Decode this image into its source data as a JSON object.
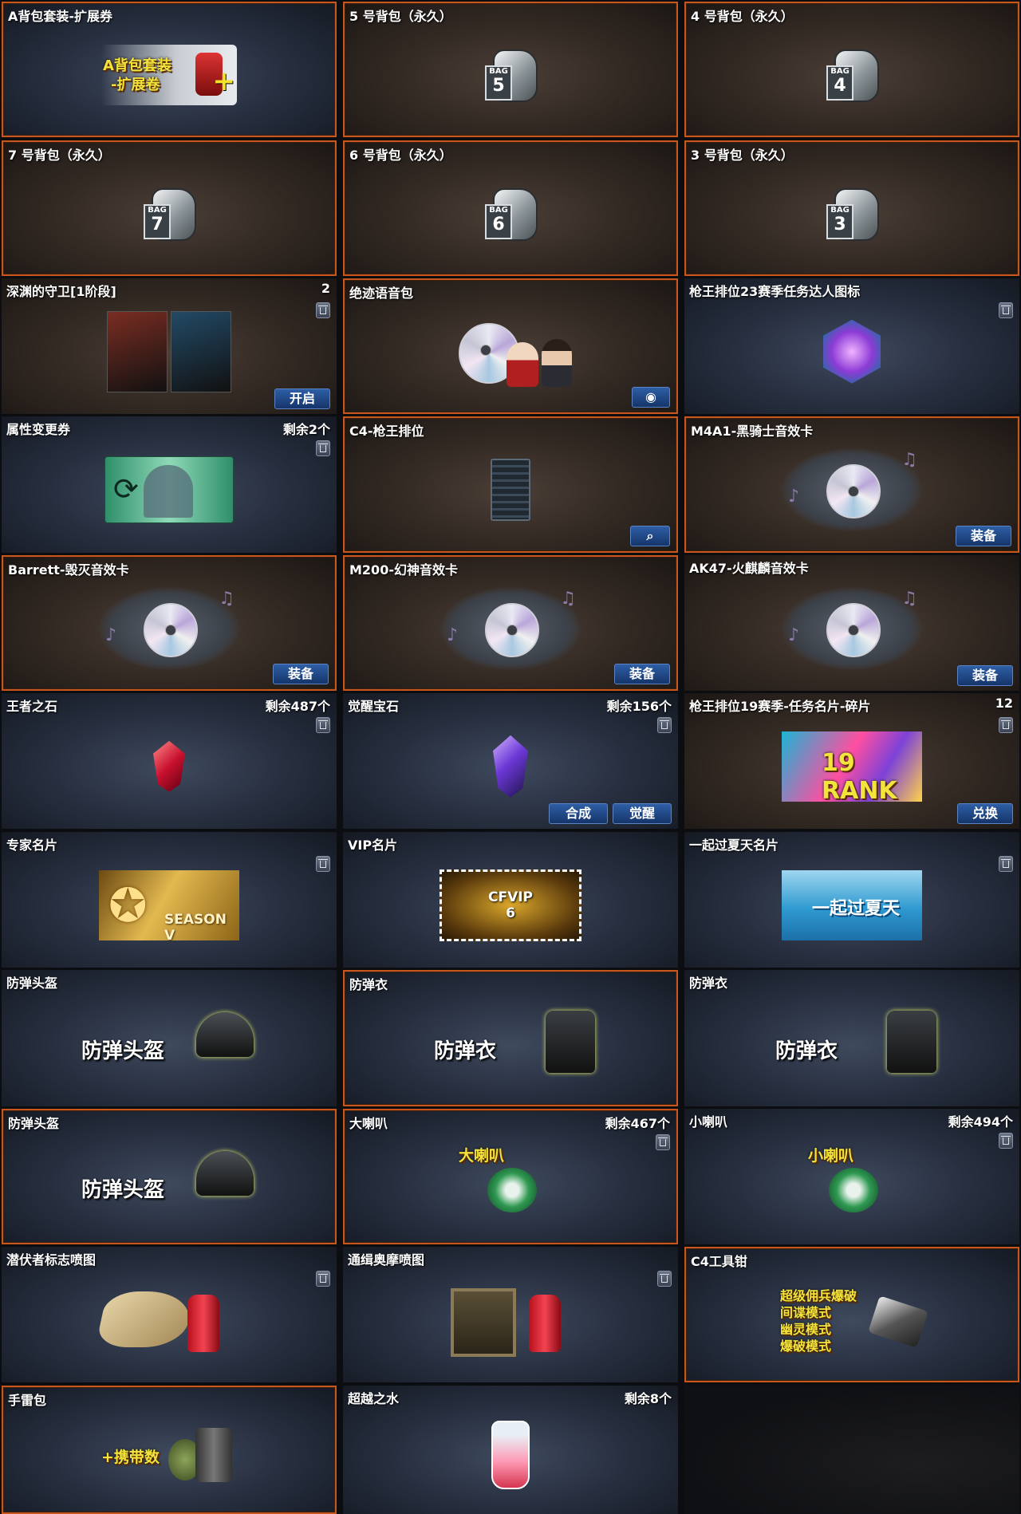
{
  "colors": {
    "orange_border": "#c7571d",
    "button_blue": "#2e5ea5",
    "panel_blue": "#293142",
    "panel_brown": "#352b25"
  },
  "items": [
    {
      "name": "A背包套装-扩展券",
      "art_text": [
        "A背包套装",
        "-扩展卷"
      ],
      "icon": "backpack-expansion-icon"
    },
    {
      "name": "5 号背包（永久）",
      "bag_number": "5",
      "bag_label": "BAG",
      "icon": "bag-icon"
    },
    {
      "name": "4 号背包（永久）",
      "bag_number": "4",
      "bag_label": "BAG",
      "icon": "bag-icon"
    },
    {
      "name": "7 号背包（永久）",
      "bag_number": "7",
      "bag_label": "BAG",
      "icon": "bag-icon"
    },
    {
      "name": "6 号背包（永久）",
      "bag_number": "6",
      "bag_label": "BAG",
      "icon": "bag-icon"
    },
    {
      "name": "3 号背包（永久）",
      "bag_number": "3",
      "bag_label": "BAG",
      "icon": "bag-icon"
    },
    {
      "name": "深渊的守卫[1阶段]",
      "count": "2",
      "button": "开启",
      "icon": "character-cards-icon"
    },
    {
      "name": "绝迹语音包",
      "icon": "voice-pack-icon"
    },
    {
      "name": "枪王排位23赛季任务达人图标",
      "icon": "trophy-badge-icon"
    },
    {
      "name": "属性变更券",
      "count": "剩余2个",
      "icon": "attribute-ticket-icon"
    },
    {
      "name": "C4-枪王排位",
      "icon": "c4-icon"
    },
    {
      "name": "M4A1-黑骑士音效卡",
      "button": "装备",
      "icon": "sound-card-icon"
    },
    {
      "name": "Barrett-毁灭音效卡",
      "button": "装备",
      "icon": "sound-card-icon"
    },
    {
      "name": "M200-幻神音效卡",
      "button": "装备",
      "icon": "sound-card-icon"
    },
    {
      "name": "AK47-火麒麟音效卡",
      "button": "装备",
      "icon": "sound-card-icon"
    },
    {
      "name": "王者之石",
      "count": "剩余487个",
      "icon": "red-gem-icon"
    },
    {
      "name": "觉醒宝石",
      "count": "剩余156个",
      "buttons": [
        "合成",
        "觉醒"
      ],
      "icon": "purple-gem-icon"
    },
    {
      "name": "枪王排位19赛季-任务名片-碎片",
      "count": "12",
      "button": "兑换",
      "art_text": "19 RANK",
      "icon": "rank-card-icon"
    },
    {
      "name": "专家名片",
      "art_text": "SEASON V",
      "icon": "expert-card-icon"
    },
    {
      "name": "VIP名片",
      "art_text": [
        "CFVIP",
        "6"
      ],
      "icon": "vip-card-icon"
    },
    {
      "name": "一起过夏天名片",
      "art_text": "一起过夏天",
      "icon": "summer-card-icon"
    },
    {
      "name": "防弹头盔",
      "art_text": "防弹头盔",
      "icon": "helmet-icon"
    },
    {
      "name": "防弹衣",
      "art_text": "防弹衣",
      "icon": "vest-icon"
    },
    {
      "name": "防弹衣",
      "art_text": "防弹衣",
      "icon": "vest-icon"
    },
    {
      "name": "防弹头盔",
      "art_text": "防弹头盔",
      "icon": "helmet-icon"
    },
    {
      "name": "大喇叭",
      "count": "剩余467个",
      "art_text": "大喇叭",
      "icon": "big-horn-icon"
    },
    {
      "name": "小喇叭",
      "count": "剩余494个",
      "art_text": "小喇叭",
      "icon": "small-horn-icon"
    },
    {
      "name": "潜伏者标志喷图",
      "icon": "spray-icon"
    },
    {
      "name": "通缉奥摩喷图",
      "icon": "spray-icon"
    },
    {
      "name": "C4工具钳",
      "art_text": [
        "超级佣兵爆破",
        "间谍模式",
        "幽灵模式",
        "爆破模式"
      ],
      "icon": "c4-pliers-icon"
    },
    {
      "name": "手雷包",
      "art_text": "+携带数",
      "icon": "grenade-pack-icon"
    },
    {
      "name": "超越之水",
      "count": "剩余8个",
      "icon": "potion-icon"
    }
  ]
}
